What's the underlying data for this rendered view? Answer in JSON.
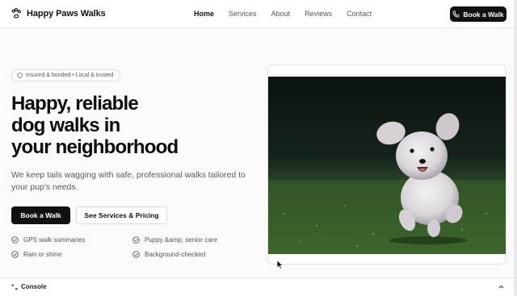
{
  "header": {
    "brand": "Happy Paws Walks",
    "nav": [
      "Home",
      "Services",
      "About",
      "Reviews",
      "Contact"
    ],
    "cta_label": "Book a Walk"
  },
  "hero": {
    "badge": "Insured & bonded • Local & trusted",
    "headline": [
      "Happy, reliable",
      "dog walks in",
      "your neighborhood"
    ],
    "subtext": "We keep tails wagging with safe, professional walks tailored to your pup's needs.",
    "primary_button": "Book a Walk",
    "secondary_button": "See Services & Pricing",
    "features": [
      "GPS walk summaries",
      "Puppy &amp; senior care",
      "Rain or shine",
      "Background-checked"
    ]
  },
  "console": {
    "label": "Console"
  },
  "colors": {
    "primary": "#111111",
    "muted_text": "#5b5b5b",
    "background": "#fafafa"
  }
}
